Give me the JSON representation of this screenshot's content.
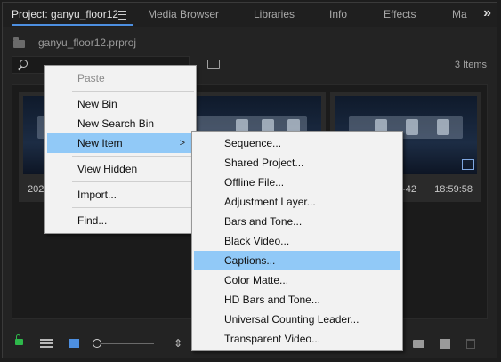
{
  "tabs": [
    {
      "label": "Project: ganyu_floor12",
      "active": true
    },
    {
      "label": "Media Browser"
    },
    {
      "label": "Libraries"
    },
    {
      "label": "Info"
    },
    {
      "label": "Effects"
    },
    {
      "label": "Ma"
    }
  ],
  "overflow_glyph": "»",
  "project": {
    "filename": "ganyu_floor12.prproj",
    "items_count": "3 Items"
  },
  "thumbnails": [
    {
      "label_left": "2021-",
      "label_right": ""
    },
    {
      "label_left": "",
      "label_right": ""
    },
    {
      "label_left": "8-42",
      "label_right": "18:59:58"
    }
  ],
  "context_menu": {
    "items": [
      {
        "label": "Paste",
        "disabled": true
      },
      {
        "separator": true
      },
      {
        "label": "New Bin"
      },
      {
        "label": "New Search Bin"
      },
      {
        "label": "New Item",
        "highlighted": true,
        "submenu": true
      },
      {
        "separator": true
      },
      {
        "label": "View Hidden"
      },
      {
        "separator": true
      },
      {
        "label": "Import..."
      },
      {
        "separator": true
      },
      {
        "label": "Find..."
      }
    ],
    "submenu_arrow": ">"
  },
  "new_item_submenu": {
    "items": [
      {
        "label": "Sequence..."
      },
      {
        "label": "Shared Project..."
      },
      {
        "label": "Offline File..."
      },
      {
        "label": "Adjustment Layer..."
      },
      {
        "label": "Bars and Tone..."
      },
      {
        "label": "Black Video..."
      },
      {
        "label": "Captions...",
        "highlighted": true
      },
      {
        "label": "Color Matte..."
      },
      {
        "label": "HD Bars and Tone..."
      },
      {
        "label": "Universal Counting Leader..."
      },
      {
        "label": "Transparent Video..."
      }
    ]
  },
  "colors": {
    "accent": "#4d8fe0",
    "menu_highlight": "#91c9f7",
    "lock_green": "#2eb84b"
  },
  "icons": {
    "search": "search-icon",
    "folder": "folder-icon",
    "lock": "lock-icon",
    "list_view": "list-view-icon",
    "icon_view": "icon-view-icon",
    "sort": "sort-icon",
    "new_bin": "new-bin-icon",
    "new_item": "new-item-icon",
    "trash": "trash-icon"
  }
}
